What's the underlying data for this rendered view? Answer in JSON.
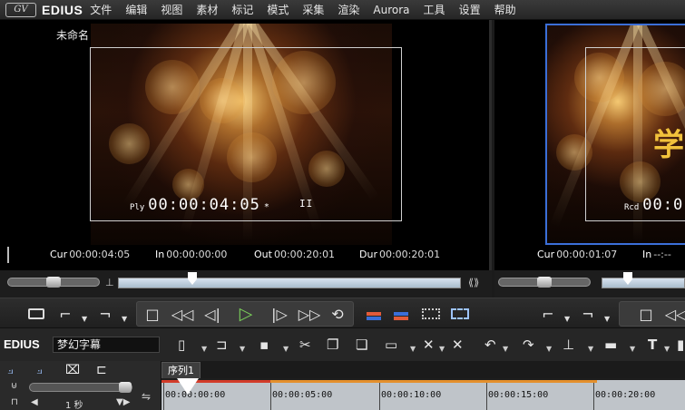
{
  "menu": {
    "logo_text": "GV",
    "app_name": "EDIUS",
    "items": [
      "文件",
      "编辑",
      "视图",
      "素材",
      "标记",
      "模式",
      "采集",
      "渲染",
      "Aurora",
      "工具",
      "设置",
      "帮助"
    ]
  },
  "player": {
    "clip_name": "未命名",
    "timecode_prefix": "Ply",
    "timecode": "00:00:04:05",
    "timecode_mark": "*",
    "pause_mark": "II",
    "cur_label": "Cur",
    "cur_value": "00:00:04:05",
    "in_label": "In",
    "in_value": "00:00:00:00",
    "out_label": "Out",
    "out_value": "00:00:20:01",
    "dur_label": "Dur",
    "dur_value": "00:00:20:01"
  },
  "recorder": {
    "timecode_prefix": "Rcd",
    "timecode": "00:0",
    "overlay_glyph": "学",
    "cur_label": "Cur",
    "cur_value": "00:00:01:07",
    "in_label": "In",
    "in_value": "--:--"
  },
  "timeline": {
    "project_label": "EDIUS",
    "project_name": "梦幻字幕",
    "sequence_tab": "序列1",
    "zoom_label": "1 秒",
    "ruler_labels": [
      "00:00:00:00",
      "00:00:05:00",
      "00:00:10:00",
      "00:00:15:00",
      "00:00:20:00"
    ]
  },
  "icons": {
    "play": "▷",
    "stop": "□",
    "rewind": "◁◁",
    "step_back": "◁|",
    "step_forward": "|▷",
    "fast_forward": "▷▷",
    "loop": "⟲",
    "mark_in": "⌐",
    "mark_out": "¬",
    "scissors": "✂",
    "text": "T"
  },
  "colors": {
    "accent_blue": "#3b6fd8",
    "play_green": "#7ad05a",
    "ruler_red": "#d23c2a",
    "ruler_orange": "#e4902c"
  }
}
